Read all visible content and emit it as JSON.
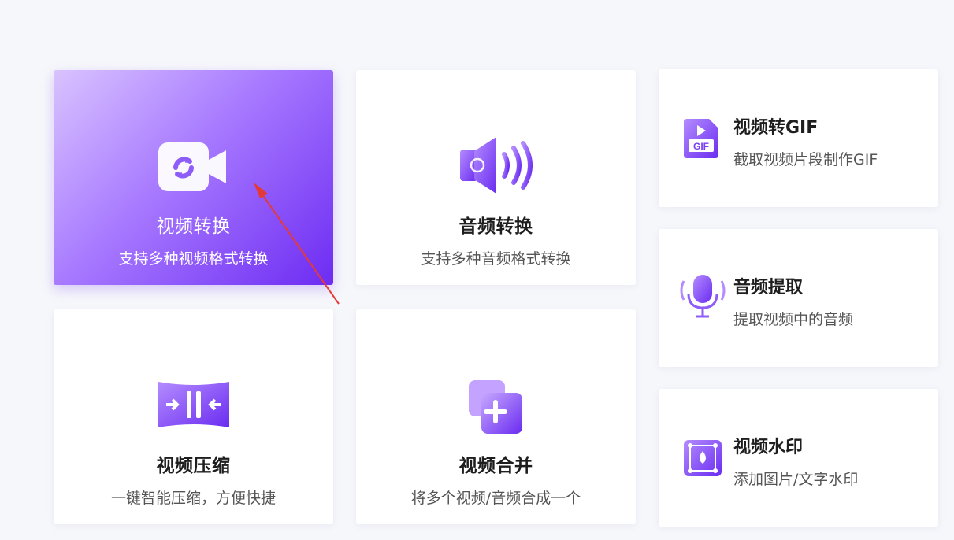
{
  "colors": {
    "accent_start": "#b48cff",
    "accent_end": "#6a2cf0",
    "arrow": "#e53935"
  },
  "cards": [
    {
      "key": "video_convert",
      "title": "视频转换",
      "desc": "支持多种视频格式转换",
      "icon": "video-convert-icon"
    },
    {
      "key": "audio_convert",
      "title": "音频转换",
      "desc": "支持多种音频格式转换",
      "icon": "audio-convert-icon"
    },
    {
      "key": "video_compress",
      "title": "视频压缩",
      "desc": "一键智能压缩，方便快捷",
      "icon": "compress-icon"
    },
    {
      "key": "video_merge",
      "title": "视频合并",
      "desc": "将多个视频/音频合成一个",
      "icon": "merge-icon"
    }
  ],
  "side_cards": [
    {
      "key": "video_gif",
      "title": "视频转GIF",
      "desc": "截取视频片段制作GIF",
      "icon": "gif-file-icon",
      "badge": "GIF"
    },
    {
      "key": "audio_extract",
      "title": "音频提取",
      "desc": "提取视频中的音频",
      "icon": "microphone-icon"
    },
    {
      "key": "video_watermark",
      "title": "视频水印",
      "desc": "添加图片/文字水印",
      "icon": "watermark-icon"
    }
  ]
}
